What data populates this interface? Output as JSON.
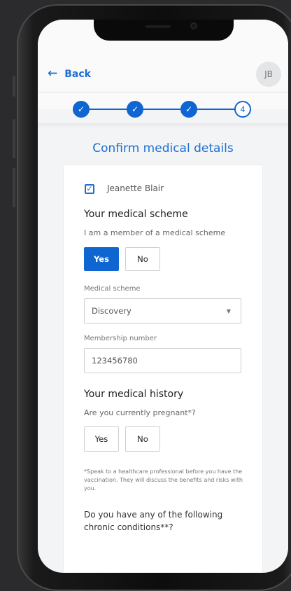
{
  "header": {
    "back_label": "Back",
    "avatar_initials": "JB"
  },
  "stepper": {
    "steps": [
      "done",
      "done",
      "done",
      "4"
    ],
    "current_step": 4
  },
  "page_title": "Confirm medical details",
  "patient": {
    "name": "Jeanette Blair",
    "checked": true
  },
  "medical_scheme": {
    "heading": "Your medical scheme",
    "question": "I am a member of a medical scheme",
    "yes_label": "Yes",
    "no_label": "No",
    "selected": "Yes",
    "scheme_label": "Medical scheme",
    "scheme_value": "Discovery",
    "membership_label": "Membership number",
    "membership_value": "123456780"
  },
  "medical_history": {
    "heading": "Your medical history",
    "pregnant_question": "Are you currently pregnant*?",
    "yes_label": "Yes",
    "no_label": "No",
    "footnote": "*Speak to a healthcare professional before you have the vaccination. They will discuss the benefits and risks with you.",
    "chronic_question": "Do you have any of the following chronic conditions**?"
  },
  "colors": {
    "accent": "#0f66d0",
    "frame": "#0d0d0d",
    "background": "#2b2b2d"
  },
  "icons": {
    "back": "arrow-left-icon",
    "check": "check-icon",
    "dropdown": "caret-down-icon"
  }
}
